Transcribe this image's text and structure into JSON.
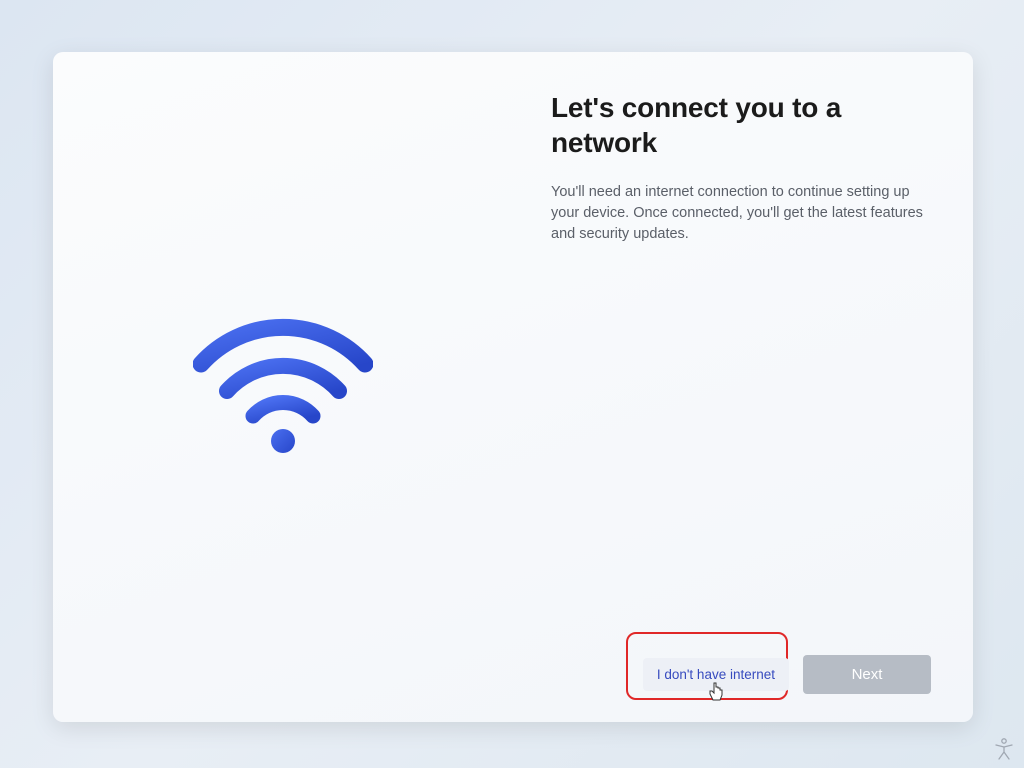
{
  "main": {
    "title": "Let's connect you to a network",
    "description": "You'll need an internet connection to continue setting up your device. Once connected, you'll get the latest features and security updates."
  },
  "buttons": {
    "no_internet": "I don't have internet",
    "next": "Next"
  },
  "icons": {
    "wifi": "wifi-icon",
    "accessibility": "accessibility-icon",
    "cursor": "pointer-cursor"
  },
  "colors": {
    "accent_blue": "#3760e8",
    "accent_dark_blue": "#2b4ac8",
    "highlight_red": "#e02828",
    "disabled_gray": "#b6bcc5"
  }
}
